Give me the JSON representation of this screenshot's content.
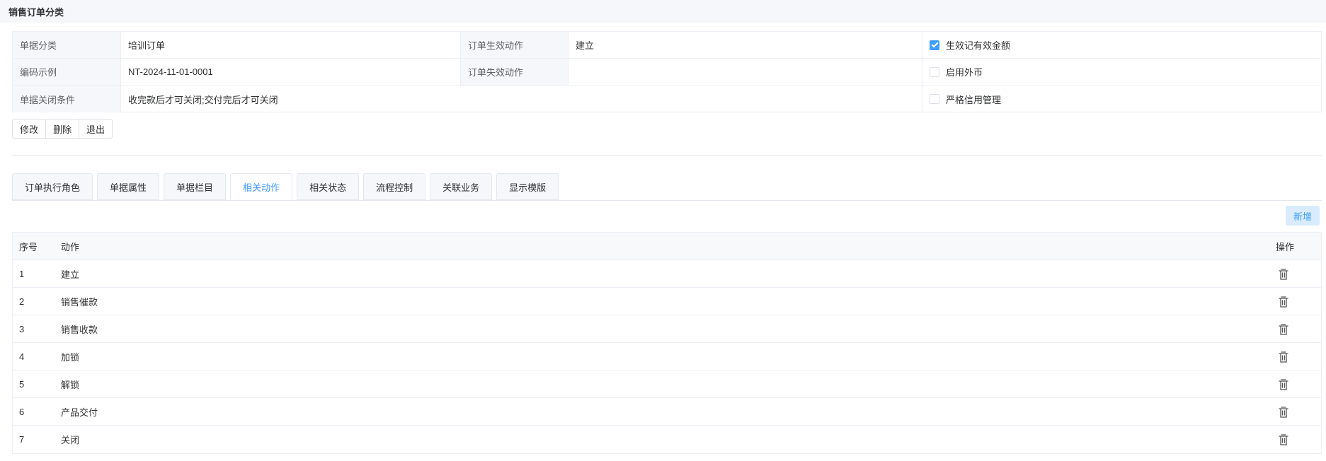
{
  "page": {
    "title": "销售订单分类"
  },
  "info": {
    "rows": [
      {
        "label1": "单据分类",
        "value1": "培训订单",
        "label2": "订单生效动作",
        "value2": "建立",
        "check_label": "生效记有效金额",
        "checked": true
      },
      {
        "label1": "编码示例",
        "value1": "NT-2024-11-01-0001",
        "label2": "订单失效动作",
        "value2": "",
        "check_label": "启用外币",
        "checked": false
      },
      {
        "label1": "单据关闭条件",
        "value1": "收完款后才可关闭;交付完后才可关闭",
        "check_label": "严格信用管理",
        "checked": false
      }
    ]
  },
  "buttons": {
    "edit": "修改",
    "delete": "删除",
    "exit": "退出"
  },
  "tabs": [
    {
      "label": "订单执行角色",
      "active": false
    },
    {
      "label": "单据属性",
      "active": false
    },
    {
      "label": "单据栏目",
      "active": false
    },
    {
      "label": "相关动作",
      "active": true
    },
    {
      "label": "相关状态",
      "active": false
    },
    {
      "label": "流程控制",
      "active": false
    },
    {
      "label": "关联业务",
      "active": false
    },
    {
      "label": "显示模版",
      "active": false
    }
  ],
  "add_button": "新增",
  "table": {
    "headers": {
      "index": "序号",
      "action": "动作",
      "ops": "操作"
    },
    "rows": [
      {
        "index": "1",
        "action": "建立"
      },
      {
        "index": "2",
        "action": "销售催款"
      },
      {
        "index": "3",
        "action": "销售收款"
      },
      {
        "index": "4",
        "action": "加锁"
      },
      {
        "index": "5",
        "action": "解锁"
      },
      {
        "index": "6",
        "action": "产品交付"
      },
      {
        "index": "7",
        "action": "关闭"
      }
    ]
  },
  "colors": {
    "accent": "#409eff",
    "accent_light": "#d9ecff",
    "header_bg": "#f5f7fa",
    "border": "#ebeef5"
  },
  "icons": {
    "row_delete": "trash-icon",
    "checkbox": "check-icon"
  }
}
